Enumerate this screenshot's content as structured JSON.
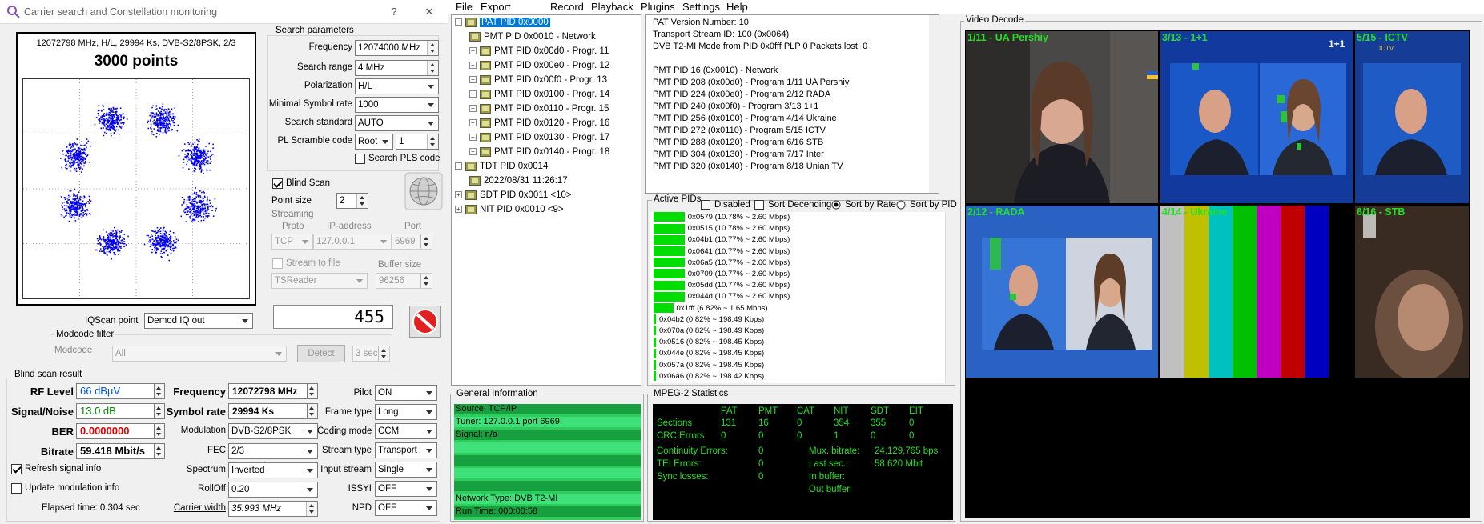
{
  "window": {
    "title": "Carrier search and Constellation monitoring",
    "help_btn": "?",
    "close_btn": "✕"
  },
  "constellation": {
    "info": "12072798 MHz, H/L, 29994 Ks, DVB-S2/8PSK, 2/3",
    "points": "3000 points"
  },
  "search": {
    "group": "Search parameters",
    "frequency_label": "Frequency",
    "frequency_value": "12074000 MHz",
    "range_label": "Search range",
    "range_value": "4 MHz",
    "polarization_label": "Polarization",
    "polarization_value": "H/L",
    "min_sr_label": "Minimal Symbol rate",
    "min_sr_value": "1000",
    "standard_label": "Search standard",
    "standard_value": "AUTO",
    "scramble_label": "PL Scramble code",
    "scramble_type": "Root",
    "scramble_value": "1",
    "search_pls": "Search PLS code"
  },
  "blind": {
    "blind_scan": "Blind Scan",
    "point_size_label": "Point size",
    "point_size_value": "2"
  },
  "streaming": {
    "group": "Streaming",
    "proto_label": "Proto",
    "ip_label": "IP-address",
    "port_label": "Port",
    "proto_value": "TCP",
    "ip_value": "127.0.0.1",
    "port_value": "6969",
    "stream_to_file": "Stream to file",
    "buffer_label": "Buffer size",
    "reader_value": "TSReader",
    "buffer_value": "96256"
  },
  "counter": "455",
  "iq": {
    "label": "IQScan point",
    "value": "Demod IQ out"
  },
  "modcode": {
    "group": "Modcode filter",
    "label": "Modcode",
    "value": "All",
    "detect": "Detect",
    "interval": "3 sec"
  },
  "result": {
    "group": "Blind scan result",
    "rf_label": "RF Level",
    "rf_value": "66 dBµV",
    "sn_label": "Signal/Noise",
    "sn_value": "13.0 dB",
    "ber_label": "BER",
    "ber_value": "0.0000000",
    "bitrate_label": "Bitrate",
    "bitrate_value": "59.418 Mbit/s",
    "freq_label": "Frequency",
    "freq_value": "12072798 MHz",
    "sr_label": "Symbol rate",
    "sr_value": "29994 Ks",
    "mod_label": "Modulation",
    "mod_value": "DVB-S2/8PSK",
    "fec_label": "FEC",
    "fec_value": "2/3",
    "spectrum_label": "Spectrum",
    "spectrum_value": "Inverted",
    "rolloff_label": "RollOff",
    "rolloff_value": "0.20",
    "carrier_label": "Carrier width",
    "carrier_value": "35.993 MHz",
    "pilot_label": "Pilot",
    "pilot_value": "ON",
    "frame_label": "Frame type",
    "frame_value": "Long",
    "coding_label": "Coding mode",
    "coding_value": "CCM",
    "streamtype_label": "Stream type",
    "streamtype_value": "Transport",
    "input_label": "Input stream",
    "input_value": "Single",
    "issyi_label": "ISSYI",
    "issyi_value": "OFF",
    "npd_label": "NPD",
    "npd_value": "OFF",
    "refresh": "Refresh signal info",
    "update_mod": "Update modulation info",
    "elapsed": "Elapsed time: 0.304 sec"
  },
  "menu": [
    "File",
    "Export",
    "Record",
    "Playback",
    "Plugins",
    "Settings",
    "Help"
  ],
  "tree": {
    "pat": "PAT PID 0x0000",
    "pmts": [
      "PMT PID 0x0010 - Network",
      "PMT PID 0x00d0 - Progr. 11",
      "PMT PID 0x00e0 - Progr. 12",
      "PMT PID 0x00f0 - Progr. 13",
      "PMT PID 0x0100 - Progr. 14",
      "PMT PID 0x0110 - Progr. 15",
      "PMT PID 0x0120 - Progr. 16",
      "PMT PID 0x0130 - Progr. 17",
      "PMT PID 0x0140 - Progr. 18"
    ],
    "tdt": "TDT PID 0x0014",
    "tdt_time": "2022/08/31 11:26:17",
    "sdt": "SDT PID 0x0011 <10>",
    "nit": "NIT PID 0x0010 <9>"
  },
  "pat_info": [
    "PAT Version Number: 10",
    "Transport Stream ID: 100 (0x0064)",
    "DVB T2-MI Mode from PID 0x0fff PLP 0 Packets lost: 0",
    "",
    "PMT PID 16 (0x0010) - Network",
    "PMT PID 208 (0x00d0) - Program 1/11 UA Pershiy",
    "PMT PID 224 (0x00e0) - Program 2/12 RADA",
    "PMT PID 240 (0x00f0) - Program 3/13 1+1",
    "PMT PID 256 (0x0100) - Program 4/14 Ukraine",
    "PMT PID 272 (0x0110) - Program 5/15 ICTV",
    "PMT PID 288 (0x0120) - Program 6/16 STB",
    "PMT PID 304 (0x0130) - Program 7/17 Inter",
    "PMT PID 320 (0x0140) - Program 8/18 Unian TV"
  ],
  "active": {
    "group": "Active PIDs",
    "disabled": "Disabled",
    "sort_desc": "Sort Decending",
    "sort_rate": "Sort by Rate",
    "sort_pid": "Sort by PID",
    "rows": [
      {
        "text": "0x0579 (10.78% ~ 2.60 Mbps)",
        "pct": 10.78
      },
      {
        "text": "0x0515 (10.78% ~ 2.60 Mbps)",
        "pct": 10.78
      },
      {
        "text": "0x04b1 (10.77% ~ 2.60 Mbps)",
        "pct": 10.77
      },
      {
        "text": "0x0641 (10.77% ~ 2.60 Mbps)",
        "pct": 10.77
      },
      {
        "text": "0x06a5 (10.77% ~ 2.60 Mbps)",
        "pct": 10.77
      },
      {
        "text": "0x0709 (10.77% ~ 2.60 Mbps)",
        "pct": 10.77
      },
      {
        "text": "0x05dd (10.77% ~ 2.60 Mbps)",
        "pct": 10.77
      },
      {
        "text": "0x044d (10.77% ~ 2.60 Mbps)",
        "pct": 10.77
      },
      {
        "text": "0x1fff (6.82% ~ 1.65 Mbps)",
        "pct": 6.82
      },
      {
        "text": "0x04b2 (0.82% ~ 198.49 Kbps)",
        "pct": 0.82
      },
      {
        "text": "0x070a (0.82% ~ 198.49 Kbps)",
        "pct": 0.82
      },
      {
        "text": "0x0516 (0.82% ~ 198.45 Kbps)",
        "pct": 0.82
      },
      {
        "text": "0x044e (0.82% ~ 198.45 Kbps)",
        "pct": 0.82
      },
      {
        "text": "0x057a (0.82% ~ 198.45 Kbps)",
        "pct": 0.82
      },
      {
        "text": "0x06a6 (0.82% ~ 198.42 Kbps)",
        "pct": 0.82
      }
    ]
  },
  "general": {
    "group": "General Information",
    "source": "Source: TCP/IP",
    "tuner": "Tuner: 127.0.0.1 port 6969",
    "signal": "Signal: n/a",
    "network": "Network Type: DVB T2-MI",
    "runtime": "Run Time: 000:00:58"
  },
  "mpeg": {
    "group": "MPEG-2 Statistics",
    "headers": [
      "PAT",
      "PMT",
      "CAT",
      "NIT",
      "SDT",
      "EIT"
    ],
    "sections_label": "Sections",
    "sections": [
      "131",
      "16",
      "0",
      "354",
      "355",
      "0"
    ],
    "crc_label": "CRC Errors",
    "crc": [
      "0",
      "0",
      "0",
      "1",
      "0",
      "0"
    ],
    "cont_label": "Continuity Errors:",
    "cont_value": "0",
    "tei_label": "TEI Errors:",
    "tei_value": "0",
    "sync_label": "Sync losses:",
    "sync_value": "0",
    "mux_label": "Mux. bitrate:",
    "mux_value": "24,129,765 bps",
    "last_label": "Last sec.:",
    "last_value": "58.620 Mbit",
    "inbuf_label": "In buffer:",
    "outbuf_label": "Out buffer:"
  },
  "video": {
    "group": "Video Decode",
    "tiles": [
      "1/11 - UA Pershiy",
      "3/13 - 1+1",
      "5/15 - ICTV",
      "2/12 - RADA",
      "4/14 - Ukraine",
      "6/16 - STB"
    ]
  },
  "colors": {
    "stat_green": "#22e022",
    "scatter_blue": "#0000ee",
    "ber_red": "#e00000",
    "rf_blue": "#0055dd",
    "sn_green": "#008800"
  }
}
